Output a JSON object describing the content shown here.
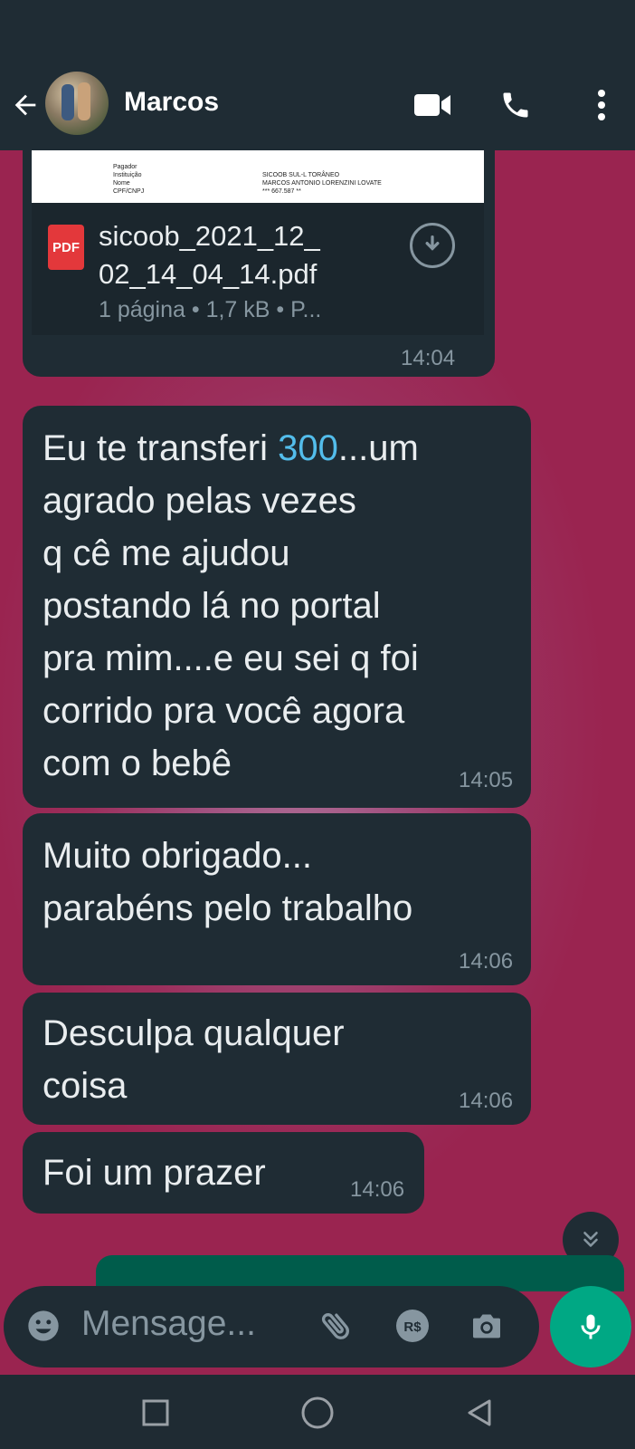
{
  "header": {
    "contact_name": "Marcos"
  },
  "document_message": {
    "file_name": "sicoob_2021_12_02_14_04_14.pdf",
    "file_name_line1": "sicoob_2021_12_",
    "file_name_line2": "02_14_04_14.pdf",
    "meta": "1 página • 1,7 kB • P...",
    "icon_label": "PDF",
    "time": "14:04",
    "preview_lines": [
      {
        "left": "Pagador",
        "right": ""
      },
      {
        "left": "Instituição",
        "right": "SICOOB SUL-L TORÂNEO"
      },
      {
        "left": "Nome",
        "right": "MARCOS ANTONIO LORENZINI LOVATE"
      },
      {
        "left": "CPF/CNPJ",
        "right": "*** 667.587 **"
      }
    ]
  },
  "messages": [
    {
      "lines": [
        "Eu te transferi ",
        "300",
        "...um",
        "agrado pelas vezes",
        "q cê me ajudou",
        "postando lá no portal",
        "pra mim....e eu sei q foi",
        "corrido pra você  agora",
        "com o bebê"
      ],
      "time": "14:05"
    },
    {
      "lines": [
        "Muito obrigado...",
        "parabéns pelo trabalho"
      ],
      "time": "14:06"
    },
    {
      "lines": [
        "Desculpa qualquer",
        "coisa"
      ],
      "time": "14:06"
    },
    {
      "lines": [
        "Foi um prazer"
      ],
      "time": "14:06"
    }
  ],
  "composer": {
    "placeholder": "Mensage..."
  },
  "icons": {
    "back": "arrow-left-icon",
    "video": "video-camera-icon",
    "call": "phone-icon",
    "menu": "more-vert-icon",
    "emoji": "emoji-icon",
    "attach": "paperclip-icon",
    "payment": "payment-icon",
    "camera": "camera-icon",
    "mic": "mic-icon"
  },
  "payment_icon_label": "R$",
  "colors": {
    "header_bg": "#1f2c34",
    "bubble_bg": "#1f2c34",
    "accent_green": "#00a884",
    "link_blue": "#53bdeb",
    "outgoing_green": "#005c4b",
    "wallpaper": "#9b2f5c"
  }
}
